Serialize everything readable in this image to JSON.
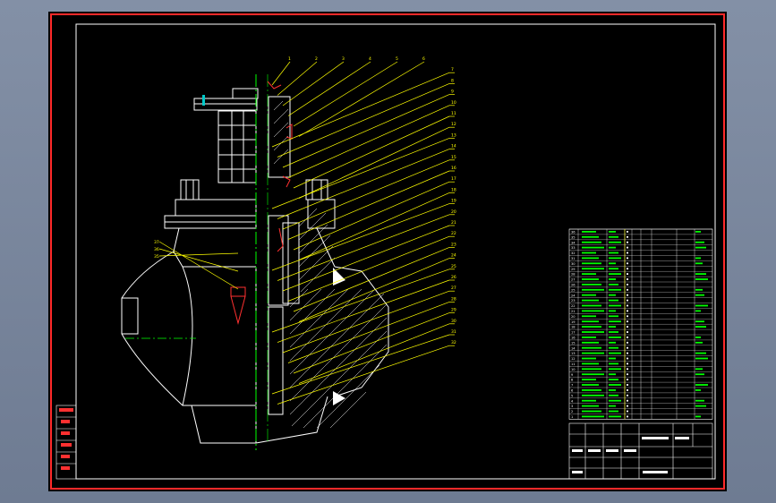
{
  "drawing": {
    "background": "#000000",
    "border_color": "#ff2a2a",
    "frame_color": "#ffffff",
    "leader_color": "#ffff00",
    "centerline_color": "#00ff00",
    "hatch_color": "#ffffff",
    "seal_color": "#ff3030",
    "handle_color": "#00c8c8"
  },
  "balloons": {
    "right_column": [
      "1",
      "2",
      "3",
      "4",
      "5",
      "6",
      "7",
      "8",
      "9",
      "10",
      "11",
      "12",
      "13",
      "14",
      "15",
      "16",
      "17",
      "18",
      "19",
      "20",
      "21",
      "22",
      "23",
      "24",
      "25",
      "26",
      "27",
      "28",
      "29",
      "30",
      "31",
      "32"
    ],
    "left_column": [
      "37",
      "36",
      "35"
    ]
  },
  "parts_list": {
    "rows": [
      [
        "36",
        "",
        "",
        "",
        "",
        "",
        ""
      ],
      [
        "35",
        "",
        "",
        "",
        "",
        "",
        ""
      ],
      [
        "34",
        "",
        "",
        "",
        "",
        "",
        ""
      ],
      [
        "33",
        "",
        "",
        "",
        "",
        "",
        ""
      ],
      [
        "32",
        "",
        "",
        "",
        "",
        "",
        ""
      ],
      [
        "31",
        "",
        "",
        "",
        "",
        "",
        ""
      ],
      [
        "30",
        "",
        "",
        "",
        "",
        "",
        ""
      ],
      [
        "29",
        "",
        "",
        "",
        "",
        "",
        ""
      ],
      [
        "28",
        "",
        "",
        "",
        "",
        "",
        ""
      ],
      [
        "27",
        "",
        "",
        "",
        "",
        "",
        ""
      ],
      [
        "26",
        "",
        "",
        "",
        "",
        "",
        ""
      ],
      [
        "25",
        "",
        "",
        "",
        "",
        "",
        ""
      ],
      [
        "24",
        "",
        "",
        "",
        "",
        "",
        ""
      ],
      [
        "23",
        "",
        "",
        "",
        "",
        "",
        ""
      ],
      [
        "22",
        "",
        "",
        "",
        "",
        "",
        ""
      ],
      [
        "21",
        "",
        "",
        "",
        "",
        "",
        ""
      ],
      [
        "20",
        "",
        "",
        "",
        "",
        "",
        ""
      ],
      [
        "19",
        "",
        "",
        "",
        "",
        "",
        ""
      ],
      [
        "18",
        "",
        "",
        "",
        "",
        "",
        ""
      ],
      [
        "17",
        "",
        "",
        "",
        "",
        "",
        ""
      ],
      [
        "16",
        "",
        "",
        "",
        "",
        "",
        ""
      ],
      [
        "15",
        "",
        "",
        "",
        "",
        "",
        ""
      ],
      [
        "14",
        "",
        "",
        "",
        "",
        "",
        ""
      ],
      [
        "13",
        "",
        "",
        "",
        "",
        "",
        ""
      ],
      [
        "12",
        "",
        "",
        "",
        "",
        "",
        ""
      ],
      [
        "11",
        "",
        "",
        "",
        "",
        "",
        ""
      ],
      [
        "10",
        "",
        "",
        "",
        "",
        "",
        ""
      ],
      [
        "9",
        "",
        "",
        "",
        "",
        "",
        ""
      ],
      [
        "8",
        "",
        "",
        "",
        "",
        "",
        ""
      ],
      [
        "7",
        "",
        "",
        "",
        "",
        "",
        ""
      ],
      [
        "6",
        "",
        "",
        "",
        "",
        "",
        ""
      ],
      [
        "5",
        "",
        "",
        "",
        "",
        "",
        ""
      ],
      [
        "4",
        "",
        "",
        "",
        "",
        "",
        ""
      ],
      [
        "3",
        "",
        "",
        "",
        "",
        "",
        ""
      ],
      [
        "2",
        "",
        "",
        "",
        "",
        "",
        ""
      ],
      [
        "1",
        "",
        "",
        "",
        "",
        "",
        ""
      ]
    ]
  }
}
